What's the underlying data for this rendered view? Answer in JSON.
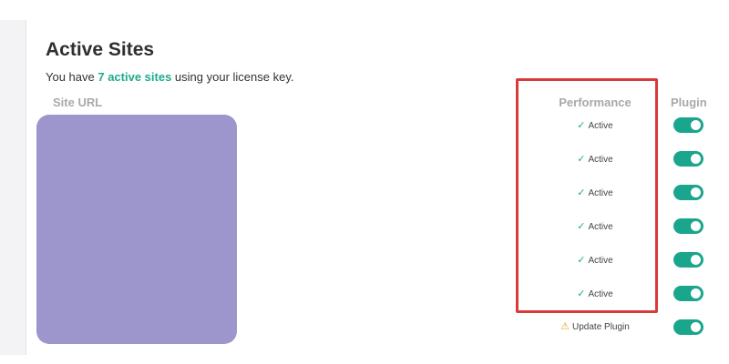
{
  "header": {
    "title": "Active Sites",
    "subtitle_prefix": "You have ",
    "subtitle_highlight": "7 active sites",
    "subtitle_suffix": " using your license key."
  },
  "table": {
    "columns": {
      "site_url": "Site URL",
      "performance": "Performance",
      "plugin": "Plugin"
    },
    "rows": [
      {
        "performance_icon": "check-icon",
        "performance_glyph": "✓",
        "performance": "Active",
        "plugin_enabled": true
      },
      {
        "performance_icon": "check-icon",
        "performance_glyph": "✓",
        "performance": "Active",
        "plugin_enabled": true
      },
      {
        "performance_icon": "check-icon",
        "performance_glyph": "✓",
        "performance": "Active",
        "plugin_enabled": true
      },
      {
        "performance_icon": "check-icon",
        "performance_glyph": "✓",
        "performance": "Active",
        "plugin_enabled": true
      },
      {
        "performance_icon": "check-icon",
        "performance_glyph": "✓",
        "performance": "Active",
        "plugin_enabled": true
      },
      {
        "performance_icon": "check-icon",
        "performance_glyph": "✓",
        "performance": "Active",
        "plugin_enabled": true
      },
      {
        "performance_icon": "warning-icon",
        "performance_glyph": "⚠",
        "performance": "Update Plugin",
        "plugin_enabled": true
      }
    ]
  },
  "colors": {
    "accent": "#1faa8f",
    "toggle_on": "#1aa68c",
    "redaction": "#9c96cc",
    "highlight_border": "#d93a3a",
    "warning": "#e5a32b"
  }
}
